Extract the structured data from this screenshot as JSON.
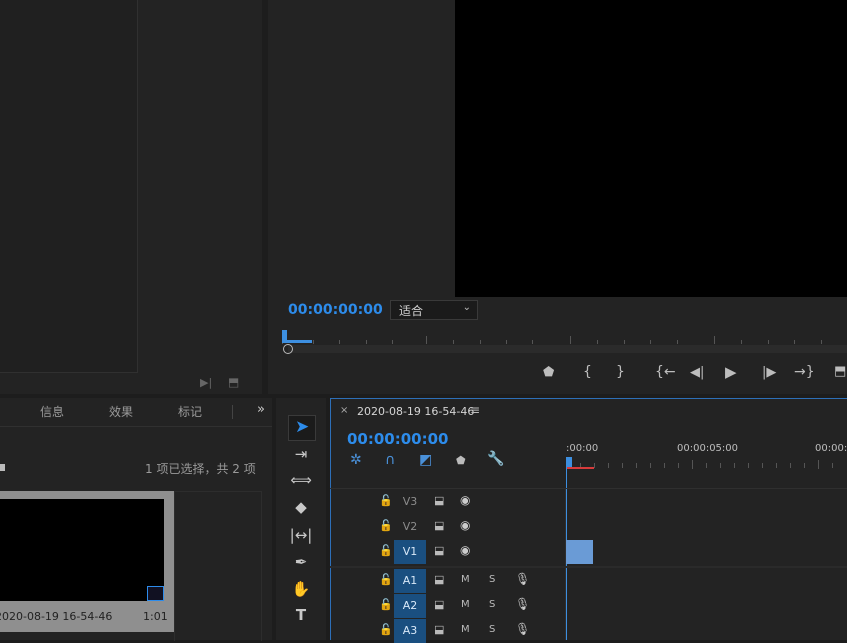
{
  "program_monitor": {
    "timecode": "00:00:00:00",
    "fit_label": "适合"
  },
  "project_panel": {
    "tabs": [
      "信息",
      "效果",
      "标记"
    ],
    "selection_status": "1 项已选择，共 2 项",
    "item": {
      "name": "2020-08-19 16-54-46",
      "duration": "1:01"
    }
  },
  "timeline": {
    "sequence_name": "2020-08-19 16-54-46",
    "timecode": "00:00:00:00",
    "ruler_labels": [
      ":00:00",
      "00:00:05:00",
      "00:00:1"
    ],
    "tracks": [
      {
        "id": "V3",
        "active": false,
        "toggle": "eye-icon"
      },
      {
        "id": "V2",
        "active": false,
        "toggle": "eye-icon"
      },
      {
        "id": "V1",
        "active": true,
        "toggle": "eye-icon"
      },
      {
        "id": "A1",
        "active": true,
        "m": "M",
        "s": "S"
      },
      {
        "id": "A2",
        "active": true,
        "m": "M",
        "s": "S"
      },
      {
        "id": "A3",
        "active": true,
        "m": "M",
        "s": "S"
      }
    ]
  },
  "colors": {
    "accent": "#2d8ceb",
    "clip": "#6a9bd6",
    "playhead": "#3d8fe0"
  }
}
